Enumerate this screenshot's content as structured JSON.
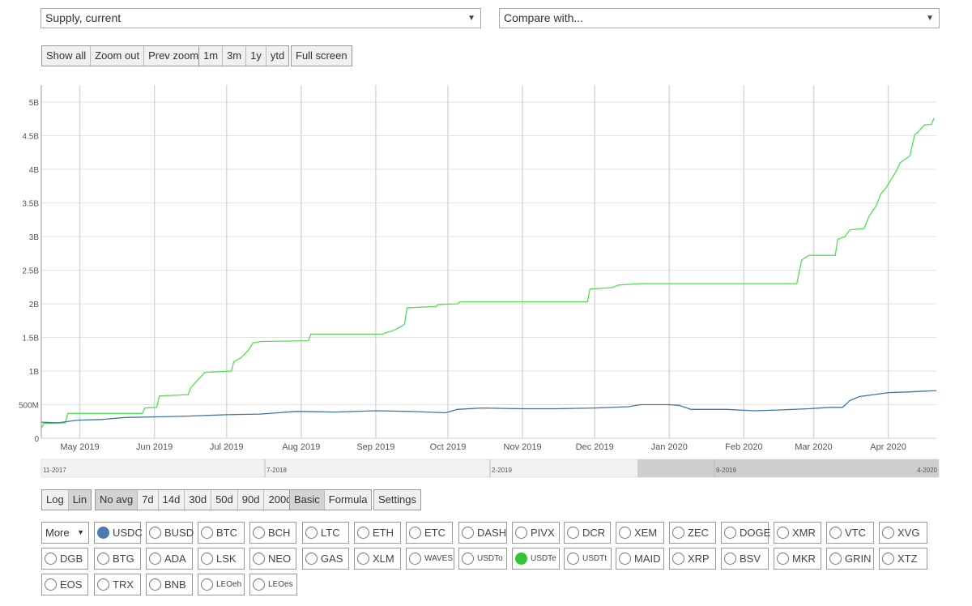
{
  "selectors": {
    "metric": "Supply, current",
    "compare": "Compare with..."
  },
  "zoom_controls": {
    "show_all": "Show all",
    "zoom_out": "Zoom out",
    "prev_zoom": "Prev zoom",
    "ranges": [
      "1m",
      "3m",
      "1y",
      "ytd"
    ],
    "full_screen": "Full screen"
  },
  "scale_controls": {
    "log": "Log",
    "lin": "Lin",
    "active": "Lin"
  },
  "avg_controls": {
    "options": [
      "No avg",
      "7d",
      "14d",
      "30d",
      "50d",
      "90d",
      "200d"
    ],
    "active": "No avg"
  },
  "mode_controls": {
    "basic": "Basic",
    "formula": "Formula",
    "active": "Basic"
  },
  "settings_label": "Settings",
  "more_label": "More",
  "colors": {
    "green_series": "#55dd55",
    "blue_series": "#3e75a6"
  },
  "coins": [
    {
      "name": "USDC",
      "checked": true,
      "color": "#4a7bab"
    },
    {
      "name": "BUSD",
      "checked": false
    },
    {
      "name": "BTC",
      "checked": false
    },
    {
      "name": "BCH",
      "checked": false
    },
    {
      "name": "LTC",
      "checked": false
    },
    {
      "name": "ETH",
      "checked": false
    },
    {
      "name": "ETC",
      "checked": false
    },
    {
      "name": "DASH",
      "checked": false
    },
    {
      "name": "PIVX",
      "checked": false
    },
    {
      "name": "DCR",
      "checked": false
    },
    {
      "name": "XEM",
      "checked": false
    },
    {
      "name": "ZEC",
      "checked": false
    },
    {
      "name": "DOGE",
      "checked": false
    },
    {
      "name": "XMR",
      "checked": false
    },
    {
      "name": "VTC",
      "checked": false
    },
    {
      "name": "XVG",
      "checked": false
    },
    {
      "name": "DGB",
      "checked": false
    },
    {
      "name": "BTG",
      "checked": false
    },
    {
      "name": "ADA",
      "checked": false
    },
    {
      "name": "LSK",
      "checked": false
    },
    {
      "name": "NEO",
      "checked": false
    },
    {
      "name": "GAS",
      "checked": false
    },
    {
      "name": "XLM",
      "checked": false
    },
    {
      "name": "WAVES",
      "checked": false
    },
    {
      "name": "USDTo",
      "checked": false
    },
    {
      "name": "USDTe",
      "checked": true,
      "color": "#33c433"
    },
    {
      "name": "USDTt",
      "checked": false
    },
    {
      "name": "MAID",
      "checked": false
    },
    {
      "name": "XRP",
      "checked": false
    },
    {
      "name": "BSV",
      "checked": false
    },
    {
      "name": "MKR",
      "checked": false
    },
    {
      "name": "GRIN",
      "checked": false
    },
    {
      "name": "XTZ",
      "checked": false
    },
    {
      "name": "EOS",
      "checked": false
    },
    {
      "name": "TRX",
      "checked": false
    },
    {
      "name": "BNB",
      "checked": false
    },
    {
      "name": "LEOeh",
      "checked": false
    },
    {
      "name": "LEOes",
      "checked": false
    }
  ],
  "chart_data": {
    "type": "line",
    "x_tick_labels": [
      "May 2019",
      "Jun 2019",
      "Jul 2019",
      "Aug 2019",
      "Sep 2019",
      "Oct 2019",
      "Nov 2019",
      "Dec 2019",
      "Jan 2020",
      "Feb 2020",
      "Mar 2020",
      "Apr 2020"
    ],
    "y_tick_labels": [
      "0",
      "500M",
      "1B",
      "1.5B",
      "2B",
      "2.5B",
      "3B",
      "3.5B",
      "4B",
      "4.5B",
      "5B"
    ],
    "ylim": [
      0,
      5000000000
    ],
    "xlim": [
      "2019-04-15",
      "2020-04-21"
    ],
    "grid": true,
    "series": [
      {
        "color": "#55dd55",
        "points": [
          [
            "2019-04-15",
            150000000
          ],
          [
            "2019-04-16",
            220000000
          ],
          [
            "2019-04-25",
            230000000
          ],
          [
            "2019-04-26",
            370000000
          ],
          [
            "2019-05-27",
            370000000
          ],
          [
            "2019-05-28",
            450000000
          ],
          [
            "2019-06-02",
            460000000
          ],
          [
            "2019-06-03",
            630000000
          ],
          [
            "2019-06-15",
            650000000
          ],
          [
            "2019-06-16",
            750000000
          ],
          [
            "2019-06-19",
            870000000
          ],
          [
            "2019-06-22",
            980000000
          ],
          [
            "2019-07-03",
            1000000000
          ],
          [
            "2019-07-04",
            1140000000
          ],
          [
            "2019-07-07",
            1200000000
          ],
          [
            "2019-07-10",
            1310000000
          ],
          [
            "2019-07-12",
            1420000000
          ],
          [
            "2019-07-14",
            1430000000
          ],
          [
            "2019-07-15",
            1440000000
          ],
          [
            "2019-08-04",
            1450000000
          ],
          [
            "2019-08-05",
            1550000000
          ],
          [
            "2019-09-04",
            1550000000
          ],
          [
            "2019-09-05",
            1570000000
          ],
          [
            "2019-09-08",
            1600000000
          ],
          [
            "2019-09-11",
            1650000000
          ],
          [
            "2019-09-13",
            1700000000
          ],
          [
            "2019-09-14",
            1940000000
          ],
          [
            "2019-09-26",
            1960000000
          ],
          [
            "2019-09-27",
            1990000000
          ],
          [
            "2019-10-05",
            2000000000
          ],
          [
            "2019-10-06",
            2030000000
          ],
          [
            "2019-11-15",
            2030000000
          ],
          [
            "2019-11-28",
            2030000000
          ],
          [
            "2019-11-29",
            2220000000
          ],
          [
            "2019-12-08",
            2240000000
          ],
          [
            "2019-12-11",
            2280000000
          ],
          [
            "2019-12-16",
            2290000000
          ],
          [
            "2019-12-20",
            2300000000
          ],
          [
            "2020-02-23",
            2300000000
          ],
          [
            "2020-02-25",
            2650000000
          ],
          [
            "2020-02-28",
            2720000000
          ],
          [
            "2020-03-10",
            2720000000
          ],
          [
            "2020-03-11",
            2960000000
          ],
          [
            "2020-03-14",
            3000000000
          ],
          [
            "2020-03-16",
            3100000000
          ],
          [
            "2020-03-22",
            3120000000
          ],
          [
            "2020-03-24",
            3300000000
          ],
          [
            "2020-03-27",
            3460000000
          ],
          [
            "2020-03-29",
            3640000000
          ],
          [
            "2020-03-31",
            3720000000
          ],
          [
            "2020-04-04",
            3950000000
          ],
          [
            "2020-04-06",
            4100000000
          ],
          [
            "2020-04-10",
            4200000000
          ],
          [
            "2020-04-12",
            4520000000
          ],
          [
            "2020-04-13",
            4540000000
          ],
          [
            "2020-04-16",
            4660000000
          ],
          [
            "2020-04-19",
            4670000000
          ],
          [
            "2020-04-20",
            4760000000
          ]
        ]
      },
      {
        "color": "#3e75a6",
        "points": [
          [
            "2019-04-15",
            240000000
          ],
          [
            "2019-04-22",
            230000000
          ],
          [
            "2019-04-30",
            270000000
          ],
          [
            "2019-05-10",
            280000000
          ],
          [
            "2019-05-20",
            310000000
          ],
          [
            "2019-06-05",
            320000000
          ],
          [
            "2019-06-15",
            330000000
          ],
          [
            "2019-07-01",
            350000000
          ],
          [
            "2019-07-15",
            360000000
          ],
          [
            "2019-07-30",
            400000000
          ],
          [
            "2019-08-15",
            390000000
          ],
          [
            "2019-09-01",
            410000000
          ],
          [
            "2019-09-15",
            400000000
          ],
          [
            "2019-09-30",
            380000000
          ],
          [
            "2019-10-05",
            430000000
          ],
          [
            "2019-10-15",
            450000000
          ],
          [
            "2019-11-01",
            440000000
          ],
          [
            "2019-11-15",
            440000000
          ],
          [
            "2019-12-01",
            450000000
          ],
          [
            "2019-12-15",
            470000000
          ],
          [
            "2019-12-20",
            500000000
          ],
          [
            "2020-01-01",
            500000000
          ],
          [
            "2020-01-05",
            490000000
          ],
          [
            "2020-01-10",
            430000000
          ],
          [
            "2020-01-25",
            430000000
          ],
          [
            "2020-02-05",
            410000000
          ],
          [
            "2020-02-15",
            420000000
          ],
          [
            "2020-02-28",
            440000000
          ],
          [
            "2020-03-08",
            460000000
          ],
          [
            "2020-03-13",
            460000000
          ],
          [
            "2020-03-16",
            560000000
          ],
          [
            "2020-03-20",
            620000000
          ],
          [
            "2020-03-26",
            650000000
          ],
          [
            "2020-04-01",
            680000000
          ],
          [
            "2020-04-10",
            690000000
          ],
          [
            "2020-04-21",
            710000000
          ]
        ]
      }
    ],
    "navigator": {
      "labels": [
        "11-2017",
        "7-2018",
        "2-2019",
        "9-2019",
        "4-2020"
      ],
      "selected_range": [
        "2019-04-15",
        "2020-04-21"
      ]
    }
  }
}
